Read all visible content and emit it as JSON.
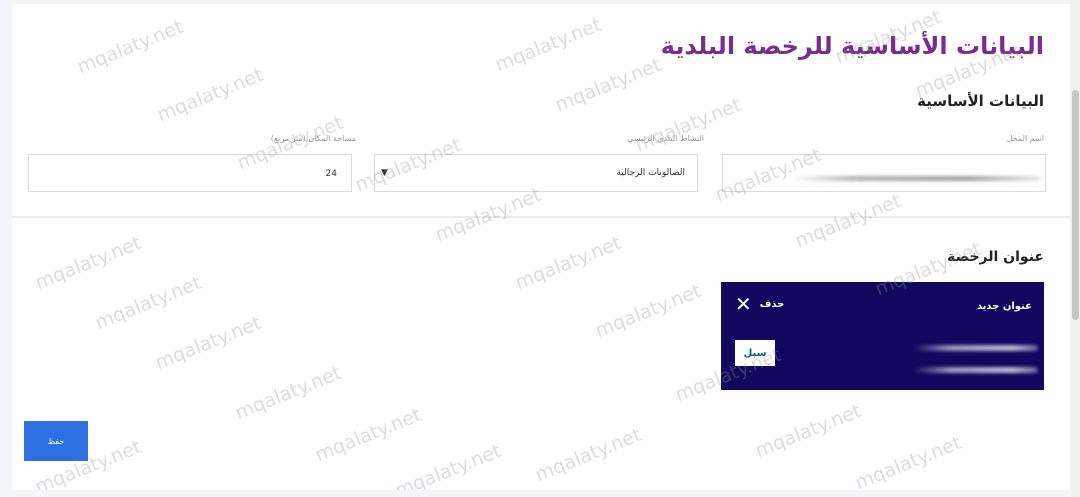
{
  "page": {
    "title": "البيانات الأساسية للرخصة البلدية"
  },
  "basic_info": {
    "section_title": "البيانات الأساسية",
    "shop_name_label": "اسم المحل",
    "activity_label": "النشاط البلدي الرئيسي",
    "activity_value": "الصالونات الرجالية",
    "area_label": "مساحة المكان (متر مربع)",
    "area_value": "24"
  },
  "license_address": {
    "section_title": "عنوان الرخصة",
    "card_title": "عنوان جديد",
    "delete_label": "حذف",
    "logo_text": "سبل"
  },
  "actions": {
    "save_label": "حفظ"
  },
  "watermark": {
    "text": "mqalaty.net"
  },
  "colors": {
    "title": "#7b2d8f",
    "card_bg": "#12075e",
    "save_button": "#2f6fe4"
  }
}
